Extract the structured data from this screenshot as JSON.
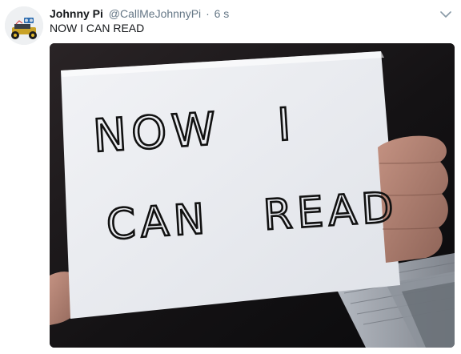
{
  "tweet": {
    "display_name": "Johnny Pi",
    "handle": "@CallMeJohnnyPi",
    "separator": "·",
    "timestamp": "6 s",
    "text": "NOW I CAN READ"
  },
  "media": {
    "sign_line_1": "NOW   I",
    "sign_line_2": "CAN   READ"
  },
  "icons": {
    "more": "chevron-down-icon",
    "avatar": "robot-car-avatar"
  },
  "colors": {
    "name": "#14171a",
    "secondary": "#657786"
  }
}
